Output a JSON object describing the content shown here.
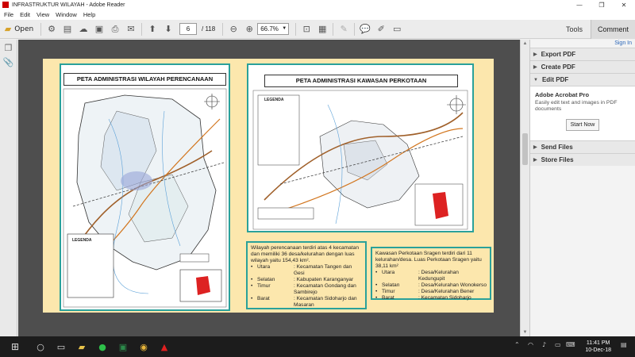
{
  "window": {
    "title": "INFRASTRUKTUR WILAYAH - Adobe Reader",
    "minimize": "—",
    "maximize": "❐",
    "close": "✕"
  },
  "menu": [
    "File",
    "Edit",
    "View",
    "Window",
    "Help"
  ],
  "toolbar": {
    "open": "Open",
    "page_current": "6",
    "page_total": "/ 118",
    "zoom": "66.7%",
    "tools": "Tools",
    "comment": "Comment"
  },
  "panel": {
    "signin": "Sign In",
    "export_pdf": "Export PDF",
    "create_pdf": "Create PDF",
    "edit_pdf": "Edit PDF",
    "acrobat_title": "Adobe Acrobat Pro",
    "acrobat_desc": "Easily edit text and images in PDF documents",
    "start_now": "Start Now",
    "send_files": "Send Files",
    "store_files": "Store Files"
  },
  "doc": {
    "map1_title": "PETA ADMINISTRASI WILAYAH PERENCANAAN",
    "map2_title": "PETA ADMINISTRASI KAWASAN PERKOTAAN",
    "legend_label": "LEGENDA",
    "box1": {
      "intro": "Wilayah perencanaan terdiri atas 4 kecamatan dan memiliki 36 desa/kelurahan dengan luas wilayah yaitu 154,43 km².",
      "rows": [
        {
          "k": "Utara",
          "v": ": Kecamatan Tangen dan Gesi"
        },
        {
          "k": "Selatan",
          "v": ": Kabupaten Karanganyar"
        },
        {
          "k": "Timur",
          "v": ": Kecamatan Gondang dan Sambirejo"
        },
        {
          "k": "Barat",
          "v": ": Kecamatan Sidoharjo dan Masaran"
        }
      ]
    },
    "box2": {
      "intro": "Kawasan Perkotaan Sragen terdiri dari 11 kelurahan/desa. Luas Perkotaan Sragen yaitu 38,11 km²",
      "rows": [
        {
          "k": "Utara",
          "v": ": Desa/Kelurahan Kedungupit"
        },
        {
          "k": "Selatan",
          "v": ": Desa/Kelurahan Wonokerso"
        },
        {
          "k": "Timur",
          "v": ": Desa/Kelurahan Bener"
        },
        {
          "k": "Barat",
          "v": ": Kecamatan Sidoharjo"
        }
      ]
    }
  },
  "taskbar": {
    "time": "11:41 PM",
    "date": "10-Dec-18"
  },
  "colors": {
    "frame": "#2aa19a",
    "page_bg": "#fce7ad",
    "doc_bg": "#4e4e4e"
  }
}
